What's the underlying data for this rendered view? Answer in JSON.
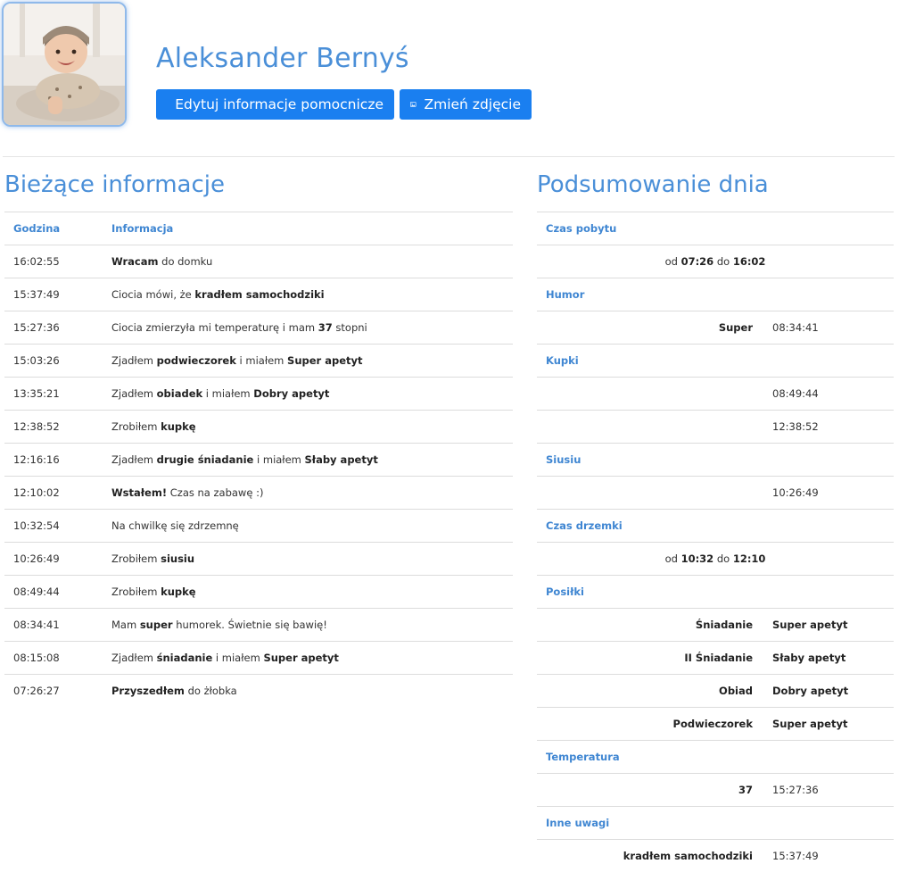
{
  "profile": {
    "name": "Aleksander Bernyś",
    "edit_button": "Edytuj informacje pomocnicze",
    "photo_button": "Zmień zdjęcie"
  },
  "current": {
    "title": "Bieżące informacje",
    "headers": {
      "time": "Godzina",
      "info": "Informacja"
    },
    "rows": [
      {
        "time": "16:02:55",
        "parts": [
          {
            "b": "Wracam"
          },
          {
            "t": " do domku"
          }
        ]
      },
      {
        "time": "15:37:49",
        "parts": [
          {
            "t": "Ciocia mówi, że "
          },
          {
            "b": "kradłem samochodziki"
          }
        ]
      },
      {
        "time": "15:27:36",
        "parts": [
          {
            "t": "Ciocia zmierzyła mi temperaturę i mam "
          },
          {
            "b": "37"
          },
          {
            "t": " stopni"
          }
        ]
      },
      {
        "time": "15:03:26",
        "parts": [
          {
            "t": "Zjadłem "
          },
          {
            "b": "podwieczorek"
          },
          {
            "t": " i miałem "
          },
          {
            "b": "Super apetyt"
          }
        ]
      },
      {
        "time": "13:35:21",
        "parts": [
          {
            "t": "Zjadłem "
          },
          {
            "b": "obiadek"
          },
          {
            "t": " i miałem "
          },
          {
            "b": "Dobry apetyt"
          }
        ]
      },
      {
        "time": "12:38:52",
        "parts": [
          {
            "t": "Zrobiłem "
          },
          {
            "b": "kupkę"
          }
        ]
      },
      {
        "time": "12:16:16",
        "parts": [
          {
            "t": "Zjadłem "
          },
          {
            "b": "drugie śniadanie"
          },
          {
            "t": " i miałem "
          },
          {
            "b": "Słaby apetyt"
          }
        ]
      },
      {
        "time": "12:10:02",
        "parts": [
          {
            "b": "Wstałem!"
          },
          {
            "t": " Czas na zabawę :)"
          }
        ]
      },
      {
        "time": "10:32:54",
        "parts": [
          {
            "t": "Na chwilkę się zdrzemnę"
          }
        ]
      },
      {
        "time": "10:26:49",
        "parts": [
          {
            "t": "Zrobiłem "
          },
          {
            "b": "siusiu"
          }
        ]
      },
      {
        "time": "08:49:44",
        "parts": [
          {
            "t": "Zrobiłem "
          },
          {
            "b": "kupkę"
          }
        ]
      },
      {
        "time": "08:34:41",
        "parts": [
          {
            "t": "Mam "
          },
          {
            "b": "super"
          },
          {
            "t": " humorek. Świetnie się bawię!"
          }
        ]
      },
      {
        "time": "08:15:08",
        "parts": [
          {
            "t": "Zjadłem "
          },
          {
            "b": "śniadanie"
          },
          {
            "t": " i miałem "
          },
          {
            "b": "Super apetyt"
          }
        ]
      },
      {
        "time": "07:26:27",
        "parts": [
          {
            "b": "Przyszedłem"
          },
          {
            "t": " do żłobka"
          }
        ]
      }
    ]
  },
  "summary": {
    "title": "Podsumowanie dnia",
    "rows": [
      {
        "type": "header",
        "text": "Czas pobytu"
      },
      {
        "type": "span",
        "parts": [
          {
            "t": "od "
          },
          {
            "b": "07:26"
          },
          {
            "t": " do "
          },
          {
            "b": "16:02"
          }
        ]
      },
      {
        "type": "header",
        "text": "Humor"
      },
      {
        "type": "pair",
        "label": "Super",
        "value": "08:34:41",
        "value_bold": false
      },
      {
        "type": "header",
        "text": "Kupki"
      },
      {
        "type": "pair",
        "label": "",
        "value": "08:49:44",
        "value_bold": false
      },
      {
        "type": "pair",
        "label": "",
        "value": "12:38:52",
        "value_bold": false
      },
      {
        "type": "header",
        "text": "Siusiu"
      },
      {
        "type": "pair",
        "label": "",
        "value": "10:26:49",
        "value_bold": false
      },
      {
        "type": "header",
        "text": "Czas drzemki"
      },
      {
        "type": "span",
        "parts": [
          {
            "t": "od "
          },
          {
            "b": "10:32"
          },
          {
            "t": " do "
          },
          {
            "b": "12:10"
          }
        ]
      },
      {
        "type": "header",
        "text": "Posiłki"
      },
      {
        "type": "pair",
        "label": "Śniadanie",
        "value": "Super apetyt",
        "value_bold": true
      },
      {
        "type": "pair",
        "label": "II Śniadanie",
        "value": "Słaby apetyt",
        "value_bold": true
      },
      {
        "type": "pair",
        "label": "Obiad",
        "value": "Dobry apetyt",
        "value_bold": true
      },
      {
        "type": "pair",
        "label": "Podwieczorek",
        "value": "Super apetyt",
        "value_bold": true
      },
      {
        "type": "header",
        "text": "Temperatura"
      },
      {
        "type": "pair",
        "label": "37",
        "value": "15:27:36",
        "value_bold": false
      },
      {
        "type": "header",
        "text": "Inne uwagi"
      },
      {
        "type": "pair",
        "label": "kradłem samochodziki",
        "value": "15:37:49",
        "value_bold": false
      }
    ]
  },
  "icons": {
    "edit": "edit-icon",
    "photo": "image-icon"
  },
  "colors": {
    "accent": "#1a7ff0",
    "heading": "#4a8fd8",
    "table_header": "#3f86d2"
  }
}
